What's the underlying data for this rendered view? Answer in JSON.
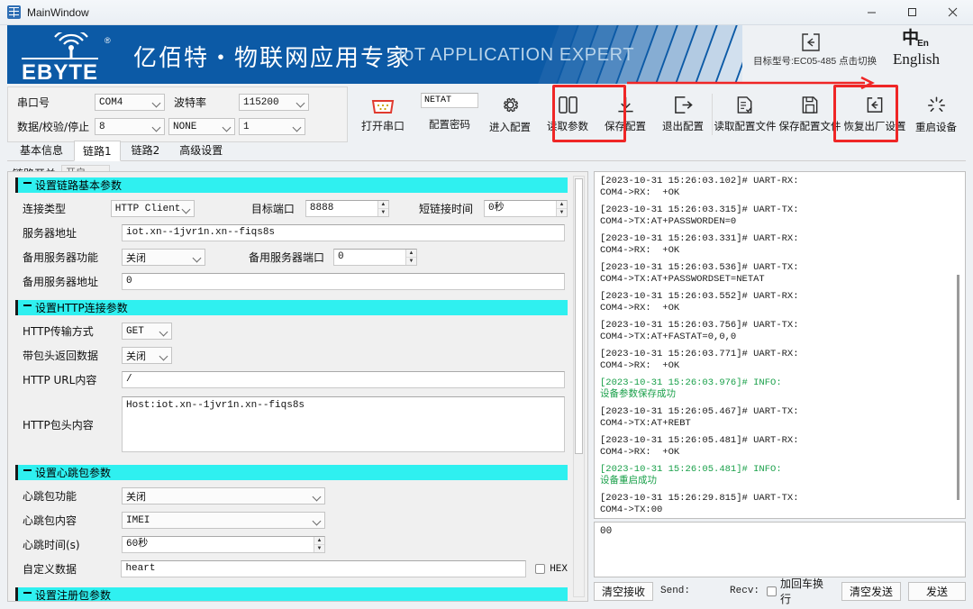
{
  "window": {
    "title": "MainWindow",
    "minimize": "–",
    "maximize": "❐",
    "close": "✕"
  },
  "banner": {
    "logo_text": "EBYTE",
    "registered": "®",
    "slogan_cn": "亿佰特・物联网应用专家",
    "slogan_en": "IoT APPLICATION EXPERT",
    "brand_color": "#0c5aa6",
    "model_text": "目标型号:EC05-485 点击切换",
    "lang_glyph": "中",
    "lang_glyph_en": "En",
    "lang_label": "English"
  },
  "serial": {
    "port_label": "串口号",
    "port_value": "COM4",
    "baud_label": "波特率",
    "baud_value": "115200",
    "frame_label": "数据/校验/停止",
    "data_bits": "8",
    "parity": "NONE",
    "stop_bits": "1",
    "open_label": "打开串口",
    "port_icon": "serial-db9-icon"
  },
  "toolbar": {
    "password_value": "NETAT",
    "password_label": "配置密码",
    "buttons": [
      {
        "label": "进入配置",
        "icon": "gear-icon",
        "highlight": false
      },
      {
        "label": "读取参数",
        "icon": "book-icon",
        "highlight": false
      },
      {
        "label": "保存配置",
        "icon": "download-icon",
        "highlight": true
      },
      {
        "label": "退出配置",
        "icon": "exit-icon",
        "highlight": false
      },
      {
        "label": "读取配置文件",
        "icon": "document-check-icon",
        "highlight": false
      },
      {
        "label": "保存配置文件",
        "icon": "floppy-save-icon",
        "highlight": false
      },
      {
        "label": "恢复出厂设置",
        "icon": "factory-reset-icon",
        "highlight": false
      },
      {
        "label": "重启设备",
        "icon": "restart-spinner-icon",
        "highlight": true
      }
    ],
    "highlight_color": "#ef2626"
  },
  "tabs": [
    {
      "label": "基本信息",
      "active": false
    },
    {
      "label": "链路1",
      "active": true
    },
    {
      "label": "链路2",
      "active": false
    },
    {
      "label": "高级设置",
      "active": false
    }
  ],
  "link_switch": {
    "label": "链路开关",
    "value": "开启"
  },
  "sections": {
    "basic": {
      "title": "设置链路基本参数",
      "conn_type_label": "连接类型",
      "conn_type_value": "HTTP Client",
      "dest_port_label": "目标端口",
      "dest_port_value": "8888",
      "short_conn_label": "短链接时间",
      "short_conn_value": "0秒",
      "server_addr_label": "服务器地址",
      "server_addr_value": "iot.xn--1jvr1n.xn--fiqs8s",
      "backup_fn_label": "备用服务器功能",
      "backup_fn_value": "关闭",
      "backup_port_label": "备用服务器端口",
      "backup_port_value": "0",
      "backup_addr_label": "备用服务器地址",
      "backup_addr_value": "0"
    },
    "http": {
      "title": "设置HTTP连接参数",
      "method_label": "HTTP传输方式",
      "method_value": "GET",
      "header_return_label": "带包头返回数据",
      "header_return_value": "关闭",
      "url_label": "HTTP URL内容",
      "url_value": "/",
      "headers_label": "HTTP包头内容",
      "headers_value": "Host:iot.xn--1jvr1n.xn--fiqs8s"
    },
    "heartbeat": {
      "title": "设置心跳包参数",
      "enable_label": "心跳包功能",
      "enable_value": "关闭",
      "content_label": "心跳包内容",
      "content_value": "IMEI",
      "interval_label": "心跳时间(s)",
      "interval_value": "60秒",
      "custom_label": "自定义数据",
      "custom_value": "heart",
      "hex_label": "HEX"
    },
    "register": {
      "title": "设置注册包参数"
    }
  },
  "log": {
    "entries": [
      {
        "head": "[2023-10-31 15:26:03.102]# UART-RX:",
        "body": "COM4->RX:  +OK",
        "type": "normal"
      },
      {
        "head": "[2023-10-31 15:26:03.315]# UART-TX:",
        "body": "COM4->TX:AT+PASSWORDEN=0",
        "type": "normal"
      },
      {
        "head": "[2023-10-31 15:26:03.331]# UART-RX:",
        "body": "COM4->RX:  +OK",
        "type": "normal"
      },
      {
        "head": "[2023-10-31 15:26:03.536]# UART-TX:",
        "body": "COM4->TX:AT+PASSWORDSET=NETAT",
        "type": "normal"
      },
      {
        "head": "[2023-10-31 15:26:03.552]# UART-RX:",
        "body": "COM4->RX:  +OK",
        "type": "normal"
      },
      {
        "head": "[2023-10-31 15:26:03.756]# UART-TX:",
        "body": "COM4->TX:AT+FASTAT=0,0,0",
        "type": "normal"
      },
      {
        "head": "[2023-10-31 15:26:03.771]# UART-RX:",
        "body": "COM4->RX:  +OK",
        "type": "normal"
      },
      {
        "head": "[2023-10-31 15:26:03.976]# INFO:",
        "body": "设备参数保存成功",
        "type": "info"
      },
      {
        "head": "[2023-10-31 15:26:05.467]# UART-TX:",
        "body": "COM4->TX:AT+REBT",
        "type": "normal"
      },
      {
        "head": "[2023-10-31 15:26:05.481]# UART-RX:",
        "body": "COM4->RX:  +OK",
        "type": "normal"
      },
      {
        "head": "[2023-10-31 15:26:05.481]# INFO:",
        "body": "设备重启成功",
        "type": "info"
      },
      {
        "head": "[2023-10-31 15:26:29.815]# UART-TX:",
        "body": "COM4->TX:00",
        "type": "normal"
      }
    ],
    "info_color": "#1aa04a"
  },
  "send": {
    "value": "00"
  },
  "controls": {
    "clear_recv": "清空接收",
    "send_count": "Send:",
    "recv_count": "Recv:",
    "crlf_label": "加回车换行",
    "clear_send": "清空发送",
    "send_button": "发送"
  }
}
